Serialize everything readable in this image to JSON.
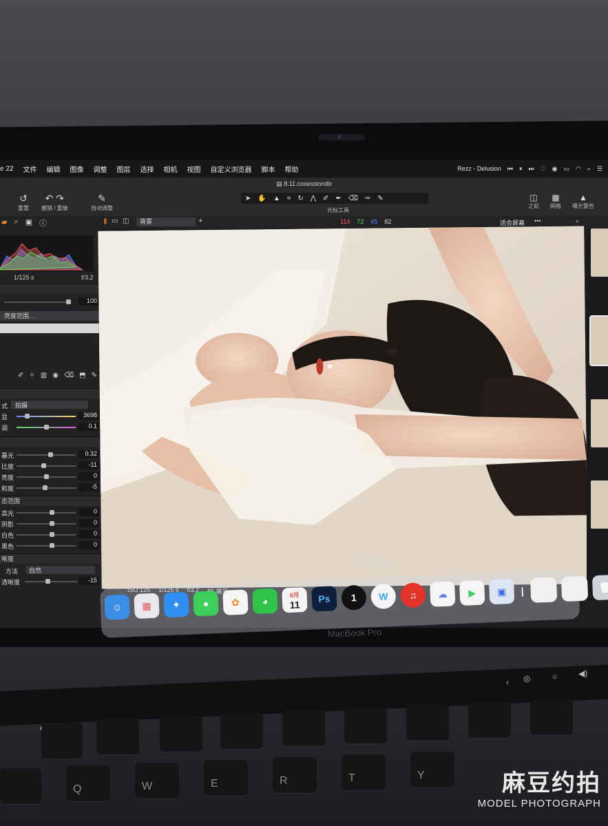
{
  "menubar": {
    "app_fragment": "e 22",
    "items": [
      "文件",
      "编辑",
      "图像",
      "调整",
      "图层",
      "选择",
      "相机",
      "视图",
      "自定义浏览器",
      "脚本",
      "帮助"
    ],
    "now_playing": "Rezz - Delusion"
  },
  "window": {
    "title": "8.11.cosessiondb"
  },
  "toolbar": {
    "buttons": [
      "重置",
      "撤销 / 重做",
      "自动调整"
    ],
    "tools_label": "光标工具",
    "right_buttons": [
      "之前",
      "网格",
      "曝光警告"
    ]
  },
  "subbar": {
    "preset": "背景",
    "rgb": {
      "r": "114",
      "g": "72",
      "b": "45",
      "a": "82"
    },
    "fit_label": "适合屏幕"
  },
  "left_panel": {
    "shutter": "1/125 s",
    "aperture": "f/3.2",
    "value_100": "100",
    "range_label": "亮度范围...",
    "wb_mode_label": "式",
    "wb_mode_value": "拍摄",
    "wb_rows": [
      {
        "label": "显",
        "value": "3698"
      },
      {
        "label": "调",
        "value": "0.1"
      }
    ],
    "exposure_rows": [
      {
        "label": "暴光",
        "value": "0.32"
      },
      {
        "label": "比度",
        "value": "-11"
      },
      {
        "label": "亮度",
        "value": "0"
      },
      {
        "label": "和度",
        "value": "-5"
      }
    ],
    "hdr_title": "态范围",
    "hdr_rows": [
      {
        "label": "高光",
        "value": "0"
      },
      {
        "label": "阴影",
        "value": "0"
      },
      {
        "label": "白色",
        "value": "0"
      },
      {
        "label": "黑色",
        "value": "0"
      }
    ],
    "clarity_title": "晰度",
    "clarity_rows": [
      {
        "label": "方法",
        "value": "自然"
      },
      {
        "label": "清晰度",
        "value": "-15"
      }
    ]
  },
  "viewer": {
    "filename": "8.119513.NEF"
  },
  "infobar": {
    "iso": "ISO 125",
    "shutter": "1/125 s",
    "aperture": "f/3.2",
    "focal": "85 毫米"
  },
  "dock": {
    "calendar_month": "8月",
    "calendar_day": "11",
    "ps_label": "Ps"
  },
  "laptop": {
    "model": "MacBook Pro",
    "esc": "esc"
  },
  "keyboard": {
    "keys": [
      "Q",
      "W",
      "E",
      "R",
      "T",
      "Y"
    ]
  },
  "watermark": {
    "cn": "麻豆约拍",
    "en": "MODEL PHOTOGRAPH"
  },
  "colors": {
    "accent": "#f08a2c",
    "r": "#ff5a5a",
    "g": "#5add5a",
    "b": "#5a8cff"
  }
}
